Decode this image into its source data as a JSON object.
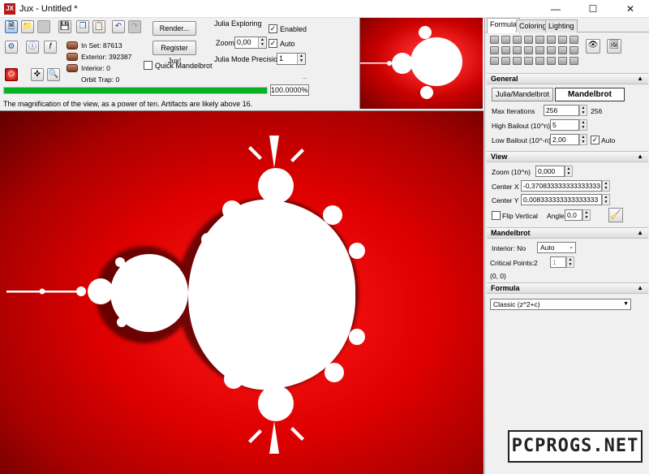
{
  "window": {
    "title": "Jux - Untitled *",
    "icon_text": "JX"
  },
  "stats": {
    "in_set": "In Set: 87613",
    "exterior": "Exterior: 392387",
    "interior": "Interior: 0",
    "orbit_trap": "Orbit Trap: 0"
  },
  "buttons": {
    "render": "Render...",
    "register": "Register Jux!"
  },
  "quick_mandelbrot": "Quick Mandelbrot",
  "julia_exploring": {
    "title": "Julia Exploring",
    "enabled_label": "Enabled",
    "zoom_label": "Zoom",
    "zoom_value": "0,00",
    "auto_label": "Auto",
    "precision_label": "Julia Mode Precision",
    "precision_value": "1",
    "ellipsis": "..."
  },
  "progress": {
    "value": 100,
    "text": "100.0000%"
  },
  "status_text": "The magnification of the view, as a power of ten. Artifacts are likely above 16.",
  "tabs": [
    "Formula",
    "Coloring",
    "Lighting"
  ],
  "general": {
    "title": "General",
    "julia_mandel_btn": "Julia/Mandelbrot",
    "mandelbrot_btn": "Mandelbrot",
    "max_iter_label": "Max Iterations",
    "max_iter_value": "256",
    "max_iter_display": "256",
    "high_bailout_label": "High Bailout (10^n)",
    "high_bailout_value": "5",
    "low_bailout_label": "Low Bailout (10^-n)",
    "low_bailout_value": "2,00",
    "auto_label": "Auto"
  },
  "view": {
    "title": "View",
    "zoom_label": "Zoom (10^n)",
    "zoom_value": "0,000",
    "center_x_label": "Center X",
    "center_x_value": "-0,370833333333333333",
    "center_y_label": "Center Y",
    "center_y_value": "0,008333333333333333",
    "flip_label": "Flip Vertical",
    "angle_label": "Angle",
    "angle_value": "0,0"
  },
  "mandelbrot": {
    "title": "Mandelbrot",
    "interior_label": "Interior: No",
    "interior_value": "Auto",
    "critical_label": "Critical Points:",
    "critical_count": "2",
    "critical_value": "1",
    "coords": "(0, 0)"
  },
  "formula": {
    "title": "Formula",
    "value": "Classic (z^2+c)"
  },
  "watermark": "PCPROGS.NET"
}
